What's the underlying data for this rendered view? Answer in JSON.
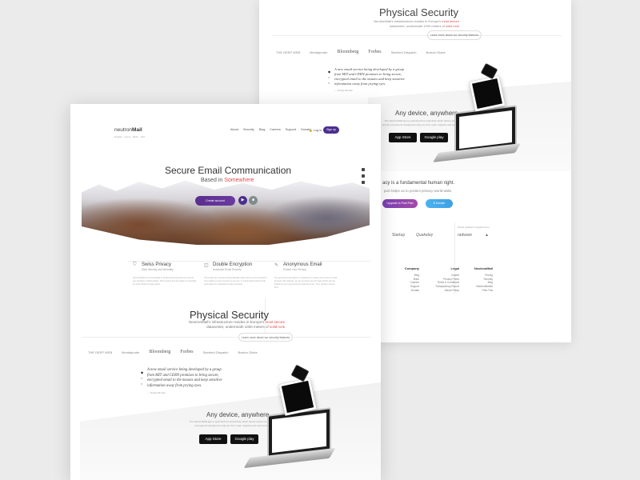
{
  "back": {
    "title": "Physical Security",
    "subtitle_pre": "NeutronMail's infrastructure resides in Europe's",
    "subtitle_hl": "most secure",
    "subtitle_line2_pre": "datacenter, underneath 1000 meters of",
    "subtitle_line2_hl": "solid rock",
    "learn_more": "Learn more about our security features",
    "press": [
      "THE DEEP WEB",
      "Mentalprobe",
      "Bloomberg",
      "Forbes",
      "Stanford Dispatch",
      "Boston Globe"
    ],
    "quote": [
      "A new email service being developed by a group",
      "from MIT and CERN promises to bring secure,",
      "encrypted email to the masses and keep sensitive",
      "information away from prying eyes."
    ],
    "quote_author": "— Stanley Brodell",
    "any_device": "Any device, anywhere",
    "any_text": "The NeutronMail app is optimized for productivity. Each device works our secure encrypted & designed to help you find, read, organize and send email.",
    "app_store": "App Store",
    "google_play": "Google play",
    "privacy": "acy is a fundamental human right.",
    "privacy_sub": "port helps us to protect privacy world-wide.",
    "upgrade": "Upgrade to Paid Plan",
    "donate": "$ Donate",
    "partners_title": "Proud recipient of grants from",
    "partners": [
      "Startup",
      "Quakeley",
      "radware"
    ],
    "footer": [
      {
        "head": "Company",
        "items": [
          "Blog",
          "Team",
          "Careers",
          "Support",
          "Donate"
        ]
      },
      {
        "head": "Legal",
        "items": [
          "Imprint",
          "Privacy Policy",
          "Terms & Conditions",
          "Transparency Report",
          "Abuse Policy"
        ]
      },
      {
        "head": "NeutronMail",
        "items": [
          "Pricing",
          "Security",
          "Blog",
          "NeutronMobile",
          "Print This"
        ]
      }
    ]
  },
  "front": {
    "logo_a": "neutron",
    "logo_b": "Mail",
    "breadcrumb": "English · Home · Back · Visit",
    "nav": [
      "About",
      "Security",
      "Blog",
      "Careers",
      "Support",
      "Donate"
    ],
    "login": "Log in",
    "signup": "Sign up",
    "hero_title": "Secure Email Communication",
    "hero_based": "Based in",
    "hero_place": "Somewhere",
    "create_account": "Create account",
    "features": [
      {
        "title": "Swiss Privacy",
        "sub": "Data Security and Neutrality",
        "desc": "NeutronMail is incorporated in Switzerland and all our servers are located in Switzerland. This means all user data is protected by strict Swiss privacy laws."
      },
      {
        "title": "Double Encryption",
        "sub": "Automatic Email Security",
        "desc": "All emails are secured automatically with end-to-end encryption. Your data is never stored on servers or transmitted without full encryption by standard email protocols."
      },
      {
        "title": "Anonymous Email",
        "sub": "Protect Your Privacy",
        "desc": "No personal information is required to create your secure email account. By default, we do not keep any IP logs which can be linked to your anonymous email account. Your privacy comes first."
      }
    ],
    "ps_title": "Physical Security",
    "ps_sub_pre": "NeutronMail's infrastructure resides in Europe's",
    "ps_sub_hl": "most secure",
    "ps_sub_line2_pre": "datacenter, underneath 1000 meters of",
    "ps_sub_line2_hl": "solid rock",
    "learn_more": "Learn more about our security features",
    "press": [
      "THE DEEP WEB",
      "Mentalprobe",
      "Bloomberg",
      "Forbes",
      "Stanford Dispatch",
      "Boston Globe"
    ],
    "quote": [
      "A new email service being developed by a group",
      "from MIT and CERN promises to bring secure,",
      "encrypted email to the masses and keep sensitive",
      "information away from prying eyes."
    ],
    "quote_author": "— Stanley Brodell",
    "any_device": "Any device, anywhere",
    "any_text": "The NeutronMail app is optimized for productivity. Each device works our secure encrypted & designed to help you find, read, organize and send email.",
    "app_store": "App Store",
    "google_play": "Google play"
  },
  "colors": {
    "accent_purple": "#4a2f8e",
    "highlight_red": "#e14b4b",
    "donate_blue": "#48b3f0"
  }
}
